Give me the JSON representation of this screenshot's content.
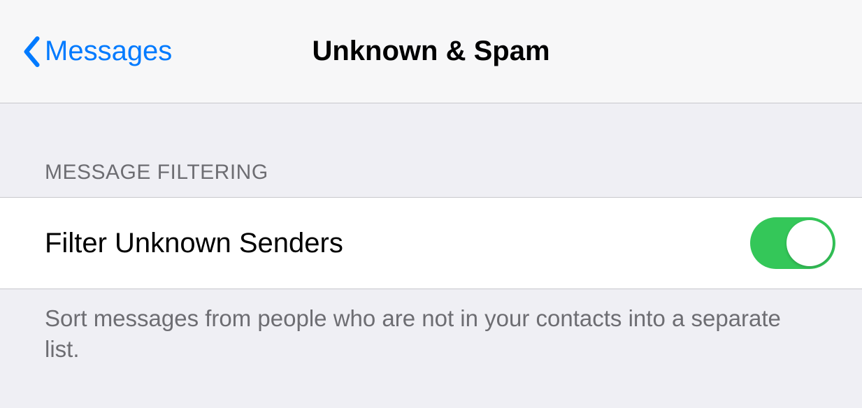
{
  "nav": {
    "back_label": "Messages",
    "title": "Unknown & Spam"
  },
  "section": {
    "header": "MESSAGE FILTERING",
    "row_label": "Filter Unknown Senders",
    "toggle_state": "on",
    "footer": "Sort messages from people who are not in your contacts into a separate list."
  },
  "colors": {
    "tint": "#007aff",
    "toggle_on": "#34c759"
  }
}
